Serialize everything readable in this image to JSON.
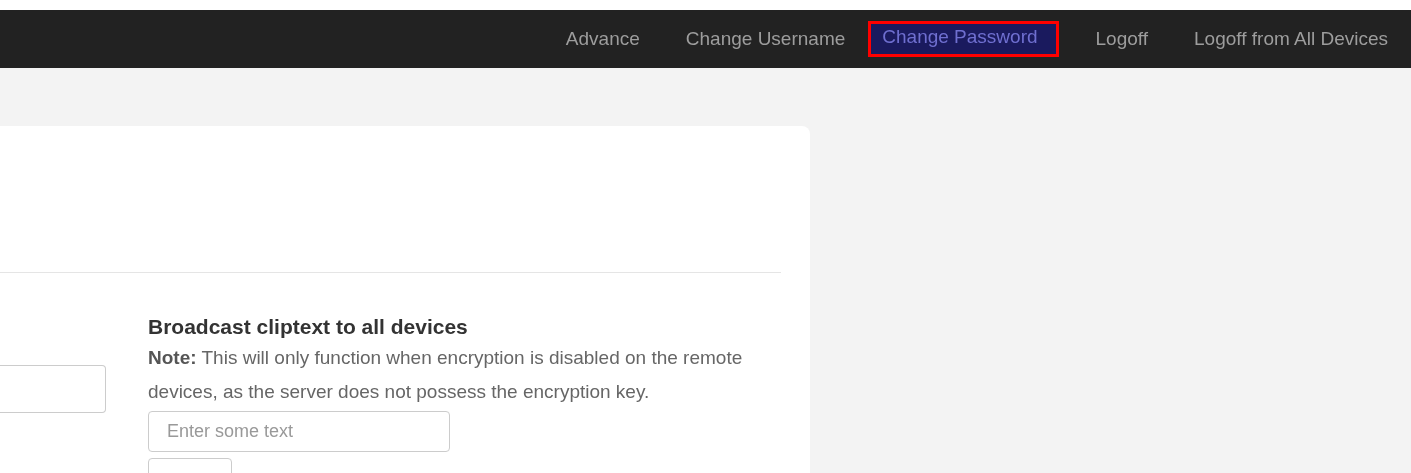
{
  "nav": {
    "items": [
      {
        "label": "Advance",
        "selected": false
      },
      {
        "label": "Change Username",
        "selected": false
      },
      {
        "label": "Change Password",
        "selected": true
      },
      {
        "label": "Logoff",
        "selected": false
      },
      {
        "label": "Logoff from All Devices",
        "selected": false
      }
    ]
  },
  "card": {
    "left_field": {
      "kind": "input"
    },
    "broadcast": {
      "title": "Broadcast cliptext to all devices",
      "note": "**Note:** This will only function when encryption is disabled on the remote devices, as the server does not possess the encryption key.",
      "placeholder": "Enter some text"
    }
  }
}
